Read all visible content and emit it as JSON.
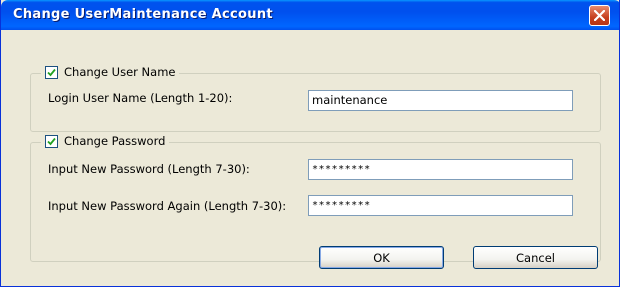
{
  "window": {
    "title": "Change UserMaintenance Account",
    "close_icon": "close-icon"
  },
  "user_name_group": {
    "checkbox_label": "Change User Name",
    "checked": true,
    "login_label": "Login User Name (Length 1-20):",
    "login_value": "maintenance"
  },
  "password_group": {
    "checkbox_label": "Change Password",
    "checked": true,
    "new_password_label": "Input New Password (Length 7-30):",
    "new_password_value": "*********",
    "again_label": "Input New Password Again (Length 7-30):",
    "again_value": "*********"
  },
  "buttons": {
    "ok": "OK",
    "cancel": "Cancel"
  },
  "colors": {
    "titlebar": "#0053ee",
    "close": "#c6401f",
    "dialog_bg": "#ece9d8",
    "field_border": "#7f9db9"
  }
}
